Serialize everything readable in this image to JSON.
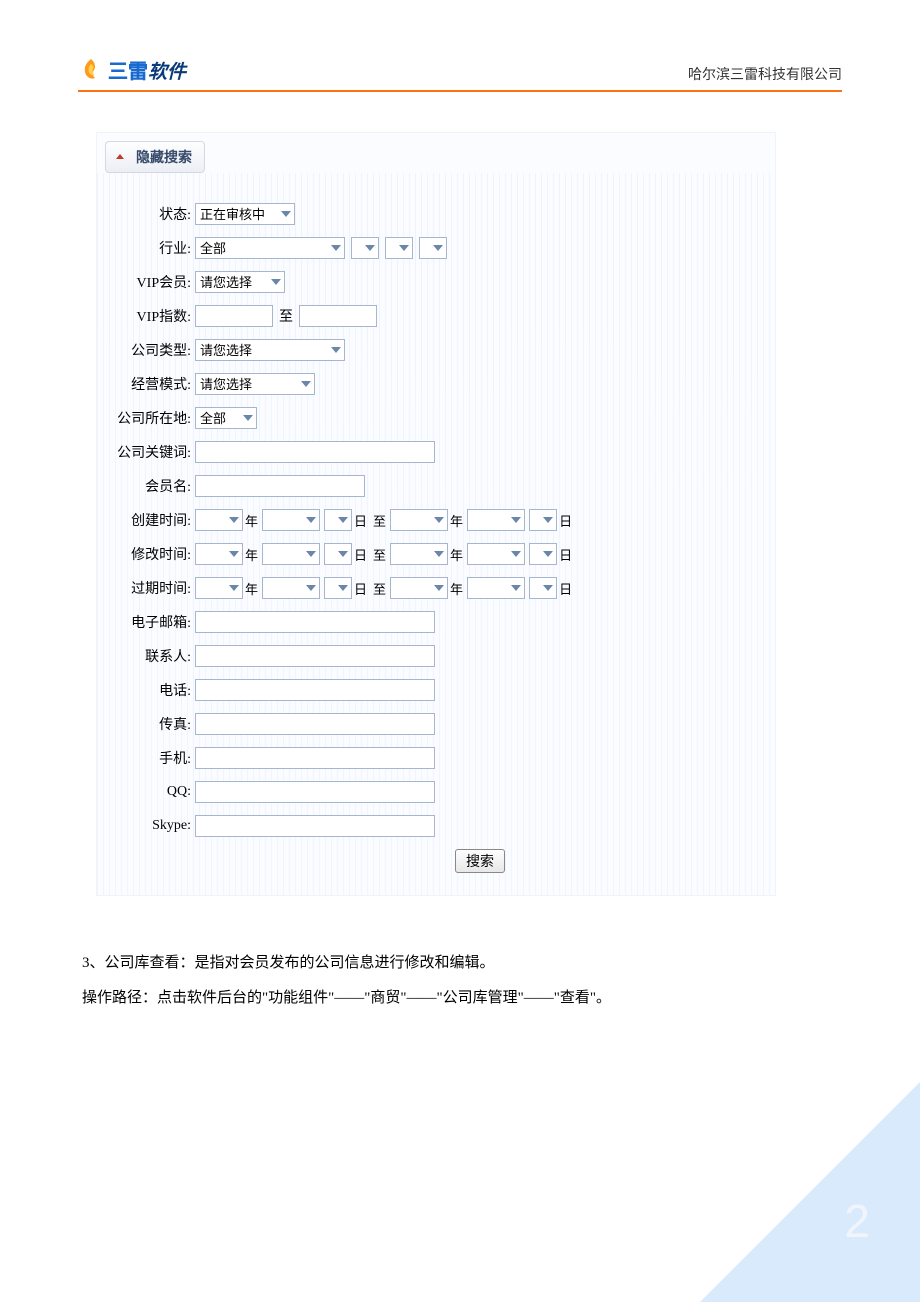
{
  "header": {
    "logo_main": "三雷",
    "logo_suffix": "软件",
    "company": "哈尔滨三雷科技有限公司"
  },
  "panel": {
    "title": "隐藏搜索"
  },
  "form": {
    "status_label": "状态:",
    "status_value": "正在审核中",
    "industry_label": "行业:",
    "industry_value": "全部",
    "vip_member_label": "VIP会员:",
    "vip_member_value": "请您选择",
    "vip_index_label": "VIP指数:",
    "vip_index_to": "至",
    "company_type_label": "公司类型:",
    "company_type_value": "请您选择",
    "biz_model_label": "经营模式:",
    "biz_model_value": "请您选择",
    "company_loc_label": "公司所在地:",
    "company_loc_value": "全部",
    "company_kw_label": "公司关键词:",
    "member_name_label": "会员名:",
    "create_time_label": "创建时间:",
    "modify_time_label": "修改时间:",
    "expire_time_label": "过期时间:",
    "date_year": "年",
    "date_day": "日",
    "date_to": "至",
    "email_label": "电子邮箱:",
    "contact_label": "联系人:",
    "phone_label": "电话:",
    "fax_label": "传真:",
    "mobile_label": "手机:",
    "qq_label": "QQ:",
    "skype_label": "Skype:",
    "search_btn": "搜索"
  },
  "body": {
    "p1": "3、公司库查看：是指对会员发布的公司信息进行修改和编辑。",
    "p2": "操作路径：点击软件后台的\"功能组件\"――\"商贸\"――\"公司库管理\"――\"查看\"。"
  },
  "page_number": "2"
}
